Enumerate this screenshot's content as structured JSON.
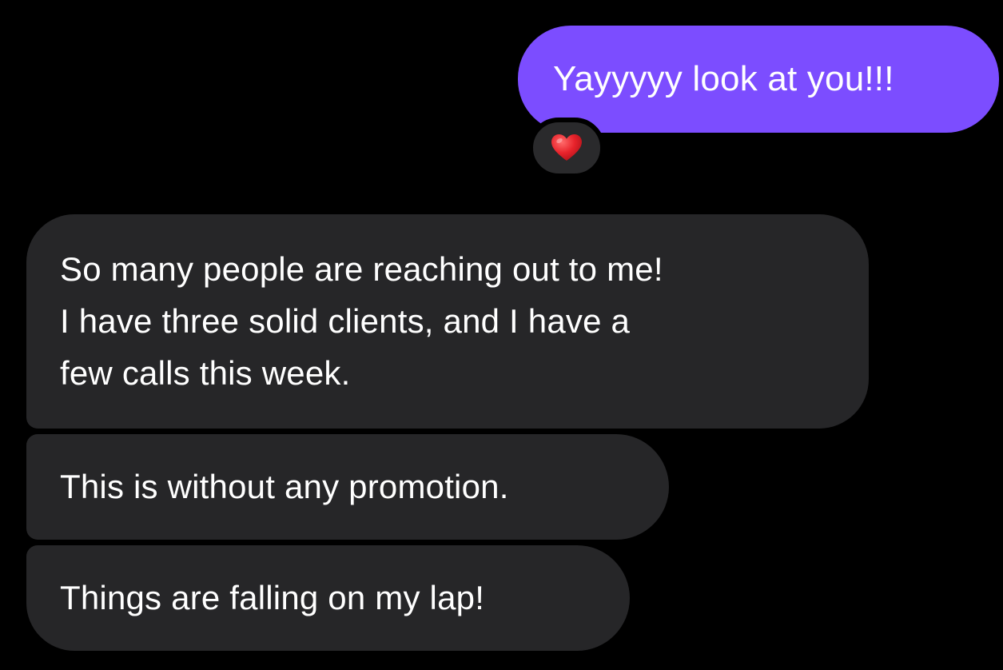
{
  "conversation": {
    "outgoing": {
      "text": "Yayyyyy look at you!!!",
      "bubble_color": "#7c4dff",
      "reaction": {
        "icon": "red-heart-icon",
        "color": "#e8232b"
      }
    },
    "incoming": [
      {
        "lines": [
          "So many people are reaching out to me!",
          "I have three solid clients, and I have a",
          "few calls this week."
        ]
      },
      {
        "lines": [
          "This is without any promotion."
        ]
      },
      {
        "lines": [
          "Things are falling on my lap!"
        ]
      }
    ],
    "incoming_bubble_color": "#262628",
    "background_color": "#000000"
  }
}
